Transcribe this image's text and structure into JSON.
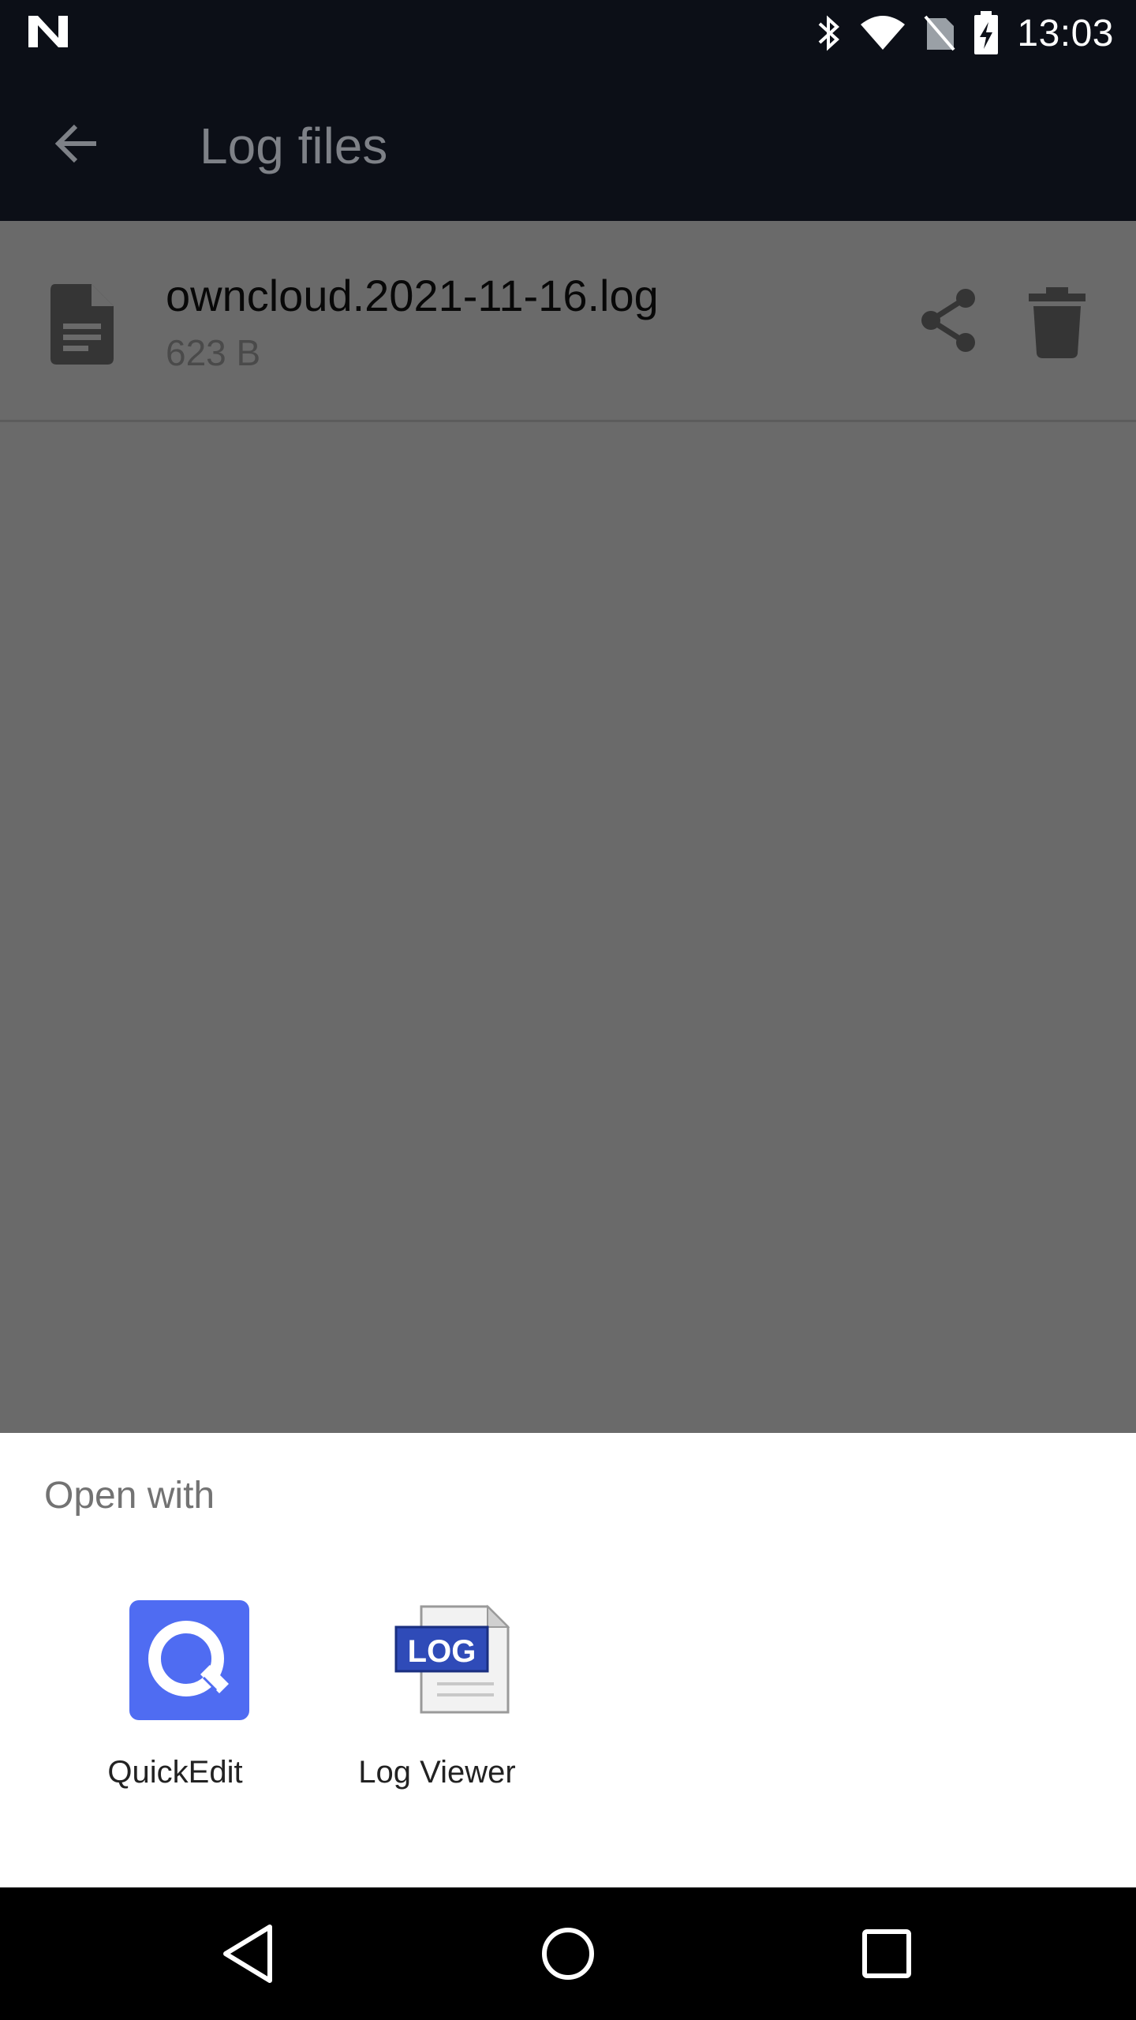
{
  "status_bar": {
    "time": "13:03",
    "icons": [
      "n-logo-icon",
      "bluetooth-icon",
      "wifi-icon",
      "no-sim-icon",
      "battery-charging-icon"
    ]
  },
  "app_bar": {
    "title": "Log files",
    "back_icon": "arrow-back-icon"
  },
  "file_list": [
    {
      "name": "owncloud.2021-11-16.log",
      "size": "623 B",
      "icon": "file-document-icon"
    }
  ],
  "open_with_sheet": {
    "title": "Open with",
    "apps": [
      {
        "label": "QuickEdit",
        "icon": "quickedit-app-icon"
      },
      {
        "label": "Log Viewer",
        "icon": "log-viewer-app-icon",
        "icon_text": "LOG"
      }
    ]
  },
  "nav_bar": {
    "buttons": [
      "back-triangle-icon",
      "home-circle-icon",
      "recents-square-icon"
    ]
  },
  "colors": {
    "status_bar_bg": "#0c0f17",
    "scrim": "#6a6a6a",
    "sheet_bg": "#ffffff",
    "quickedit_blue": "#4f6cf2",
    "log_blue": "#2f4bb8"
  }
}
